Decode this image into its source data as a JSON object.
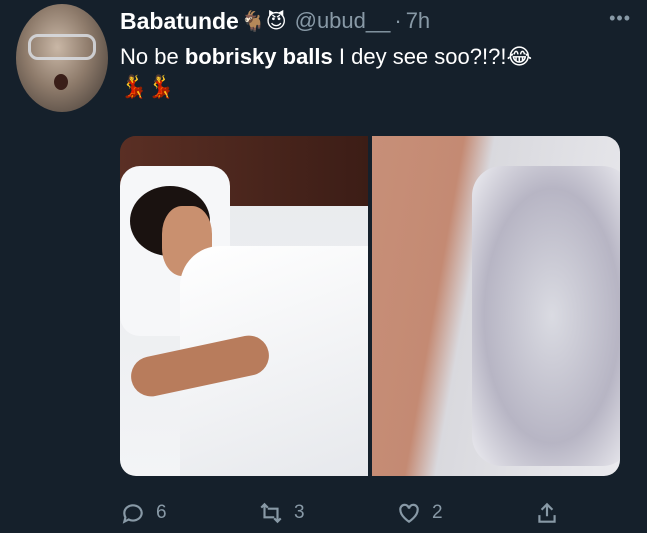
{
  "tweet": {
    "author_name": "Babatunde",
    "author_emojis": "🐐😈",
    "handle": "@ubud__",
    "separator": "·",
    "time": "7h",
    "more": "•••",
    "text_pre": "No be ",
    "text_bold": "bobrisky balls",
    "text_post": " I dey see soo?!?!",
    "text_emoji": "😂",
    "second_line_emojis": "💃💃"
  },
  "actions": {
    "reply_count": "6",
    "retweet_count": "3",
    "like_count": "2"
  },
  "colors": {
    "background": "#15202b",
    "secondary_text": "#8899a6",
    "primary_text": "#ffffff"
  },
  "icons": [
    "reply-icon",
    "retweet-icon",
    "like-icon",
    "share-icon",
    "more-icon"
  ]
}
